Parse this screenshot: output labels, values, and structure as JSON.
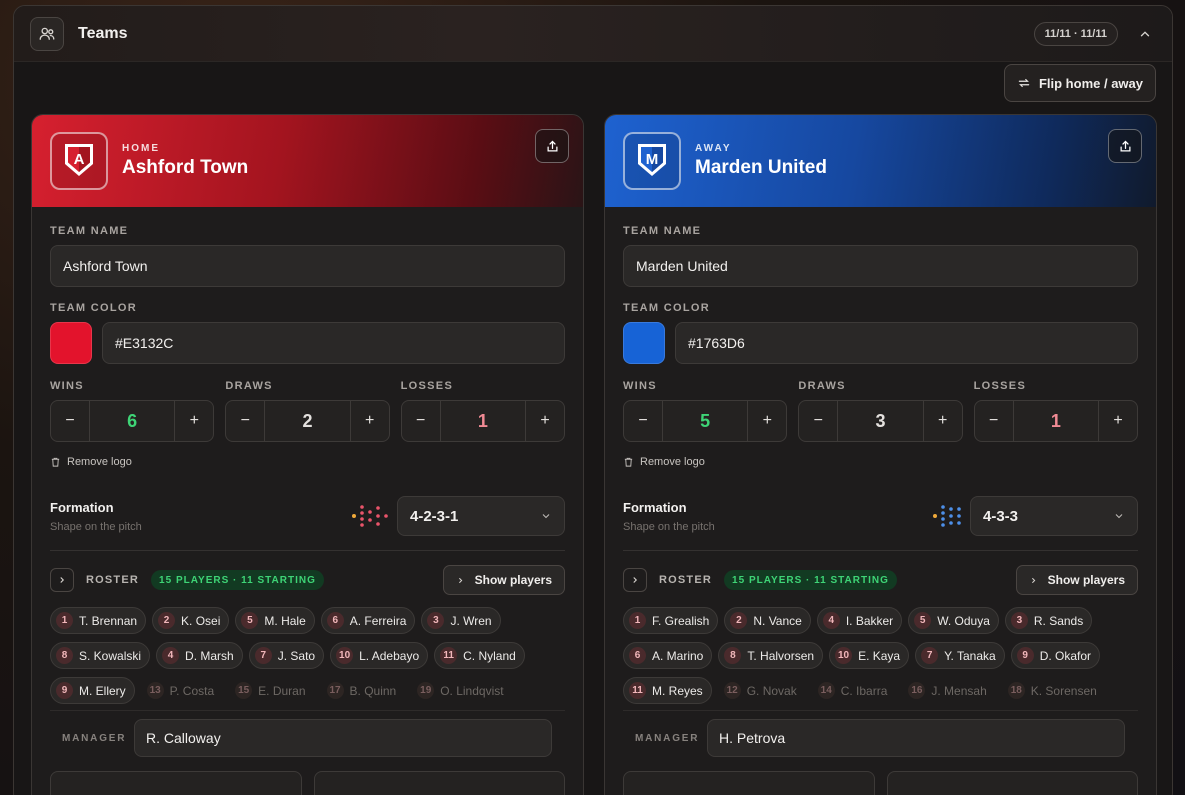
{
  "header": {
    "title": "Teams",
    "range": "11/11 · 11/11",
    "flip_label": "Flip home / away"
  },
  "labels": {
    "team_name": "TEAM NAME",
    "team_color": "TEAM COLOR",
    "wins": "WINS",
    "draws": "DRAWS",
    "losses": "LOSSES",
    "remove_logo": "Remove logo",
    "formation": "Formation",
    "formation_sub": "Shape on the pitch",
    "roster": "ROSTER",
    "show_players": "Show players",
    "manager": "MANAGER",
    "minus": "−",
    "plus": "+"
  },
  "home": {
    "side": "HOME",
    "name": "Ashford Town",
    "crest_letter": "A",
    "color": "#E3132C",
    "wins": "6",
    "draws": "2",
    "losses": "1",
    "formation": "4-2-3-1",
    "roster_badge": "15 PLAYERS · 11 STARTING",
    "manager": "R. Calloway",
    "players": [
      {
        "num": "1",
        "name": "T. Brennan",
        "starting": true
      },
      {
        "num": "2",
        "name": "K. Osei",
        "starting": true
      },
      {
        "num": "5",
        "name": "M. Hale",
        "starting": true
      },
      {
        "num": "6",
        "name": "A. Ferreira",
        "starting": true
      },
      {
        "num": "3",
        "name": "J. Wren",
        "starting": true
      },
      {
        "num": "8",
        "name": "S. Kowalski",
        "starting": true
      },
      {
        "num": "4",
        "name": "D. Marsh",
        "starting": true
      },
      {
        "num": "7",
        "name": "J. Sato",
        "starting": true
      },
      {
        "num": "10",
        "name": "L. Adebayo",
        "starting": true
      },
      {
        "num": "11",
        "name": "C. Nyland",
        "starting": true
      },
      {
        "num": "9",
        "name": "M. Ellery",
        "starting": true
      },
      {
        "num": "13",
        "name": "P. Costa",
        "starting": false
      },
      {
        "num": "15",
        "name": "E. Duran",
        "starting": false
      },
      {
        "num": "17",
        "name": "B. Quinn",
        "starting": false
      },
      {
        "num": "19",
        "name": "O. Lindqvist",
        "starting": false
      }
    ]
  },
  "away": {
    "side": "AWAY",
    "name": "Marden United",
    "crest_letter": "M",
    "color": "#1763D6",
    "wins": "5",
    "draws": "3",
    "losses": "1",
    "formation": "4-3-3",
    "roster_badge": "15 PLAYERS · 11 STARTING",
    "manager": "H. Petrova",
    "players": [
      {
        "num": "1",
        "name": "F. Grealish",
        "starting": true
      },
      {
        "num": "2",
        "name": "N. Vance",
        "starting": true
      },
      {
        "num": "4",
        "name": "I. Bakker",
        "starting": true
      },
      {
        "num": "5",
        "name": "W. Oduya",
        "starting": true
      },
      {
        "num": "3",
        "name": "R. Sands",
        "starting": true
      },
      {
        "num": "6",
        "name": "A. Marino",
        "starting": true
      },
      {
        "num": "8",
        "name": "T. Halvorsen",
        "starting": true
      },
      {
        "num": "10",
        "name": "E. Kaya",
        "starting": true
      },
      {
        "num": "7",
        "name": "Y. Tanaka",
        "starting": true
      },
      {
        "num": "9",
        "name": "D. Okafor",
        "starting": true
      },
      {
        "num": "11",
        "name": "M. Reyes",
        "starting": true
      },
      {
        "num": "12",
        "name": "G. Novak",
        "starting": false
      },
      {
        "num": "14",
        "name": "C. Ibarra",
        "starting": false
      },
      {
        "num": "16",
        "name": "J. Mensah",
        "starting": false
      },
      {
        "num": "18",
        "name": "K. Sorensen",
        "starting": false
      }
    ]
  },
  "colors": {
    "win": "#3ed476",
    "loss": "#f08a94",
    "accent_home": "#E3132C",
    "accent_away": "#1763D6"
  },
  "icons": {
    "header": "users-icon",
    "collapse": "chevron-up-icon",
    "flip": "swap-icon",
    "share": "share-icon",
    "trash": "trash-icon",
    "dropdown": "chevron-down-icon",
    "roster": "chevron-right-icon"
  }
}
